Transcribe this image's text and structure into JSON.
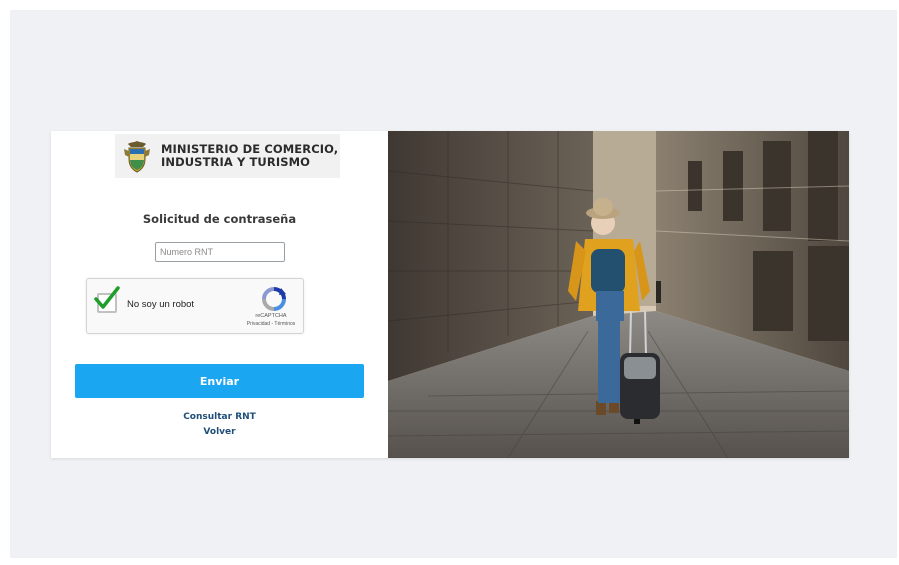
{
  "logo": {
    "line1": "MINISTERIO DE COMERCIO,",
    "line2": "INDUSTRIA Y TURISMO",
    "icon": "colombia-coat-of-arms-icon"
  },
  "form": {
    "heading": "Solicitud de contraseña",
    "rnt_placeholder": "Numero RNT",
    "rnt_value": ""
  },
  "captcha": {
    "label": "No soy un robot",
    "brand": "reCAPTCHA",
    "links": "Privacidad - Términos",
    "checked": true,
    "check_color": "#1e9e2a"
  },
  "submit": {
    "label": "Enviar",
    "color": "#1aa6f0"
  },
  "links": {
    "consult": "Consultar RNT",
    "back": "Volver"
  },
  "hero": {
    "description_icon": "traveler-with-suitcase-photo"
  }
}
